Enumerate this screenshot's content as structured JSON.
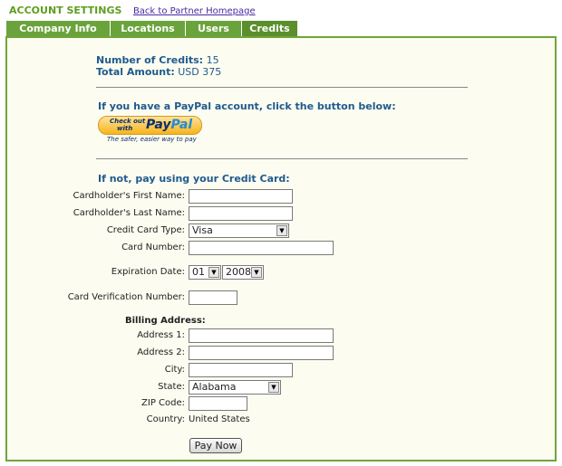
{
  "header": {
    "title": "ACCOUNT SETTINGS",
    "back_link": "Back to Partner Homepage"
  },
  "tabs": [
    {
      "label": "Company Info"
    },
    {
      "label": "Locations"
    },
    {
      "label": "Users"
    },
    {
      "label": "Credits",
      "active": true
    }
  ],
  "summary": {
    "credits_label": "Number of Credits:",
    "credits_value": "15",
    "amount_label": "Total Amount:",
    "amount_value": "USD 375"
  },
  "paypal": {
    "prompt": "If you have a PayPal account, click the button below:",
    "check_out": "Check out",
    "with": "with",
    "logo_pay": "Pay",
    "logo_pal": "Pal",
    "tagline": "The safer, easier way to pay"
  },
  "card": {
    "prompt": "If not, pay using your Credit Card:",
    "first_name_label": "Cardholder's First Name:",
    "first_name_value": "",
    "last_name_label": "Cardholder's Last Name:",
    "last_name_value": "",
    "type_label": "Credit Card Type:",
    "type_value": "Visa",
    "number_label": "Card Number:",
    "number_value": "",
    "expiration_label": "Expiration Date:",
    "exp_month": "01",
    "exp_year": "2008",
    "cvn_label": "Card Verification Number:",
    "cvn_value": ""
  },
  "billing": {
    "heading": "Billing Address:",
    "address1_label": "Address 1:",
    "address1_value": "",
    "address2_label": "Address 2:",
    "address2_value": "",
    "city_label": "City:",
    "city_value": "",
    "state_label": "State:",
    "state_value": "Alabama",
    "zip_label": "ZIP Code:",
    "zip_value": "",
    "country_label": "Country:",
    "country_value": "United States"
  },
  "submit": {
    "label": "Pay Now"
  },
  "colors": {
    "green_tab": "#6aa33b",
    "green_title": "#5e9e1f",
    "blue_text": "#1f5a8f",
    "panel_bg": "#fcfcf0"
  }
}
